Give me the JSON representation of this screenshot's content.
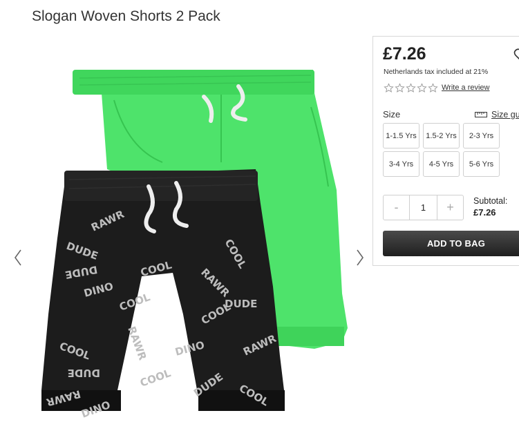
{
  "product": {
    "title": "Slogan Woven Shorts 2 Pack",
    "price": "£7.26",
    "tax_note": "Netherlands tax included at 21%",
    "rating_stars": 0,
    "review_link": "Write a review"
  },
  "size": {
    "label": "Size",
    "guide_label": "Size gui",
    "options": [
      "1-1.5 Yrs",
      "1.5-2 Yrs",
      "2-3 Yrs",
      "3-4 Yrs",
      "4-5 Yrs",
      "5-6 Yrs"
    ]
  },
  "quantity": {
    "minus": "-",
    "value": "1",
    "plus": "+"
  },
  "subtotal": {
    "label": "Subtotal:",
    "value": "£7.26"
  },
  "cart": {
    "add_label": "ADD TO BAG"
  },
  "image": {
    "print_words": [
      "DINO",
      "COOL",
      "RAWR",
      "DUDE",
      "DINO",
      "COOL",
      "RAWR",
      "DUDE",
      "DINO",
      "COOL",
      "DUDE",
      "RAWR",
      "COOL",
      "DINO",
      "DUDE",
      "RAWR",
      "COOL",
      "DINO",
      "DUDE",
      "COOL"
    ]
  },
  "colors": {
    "green_shorts": "#4ee36b",
    "black_shorts": "#1c1c1c",
    "button": "#2a2a2a"
  },
  "icons": {
    "prev": "chevron-left-icon",
    "next": "chevron-right-icon",
    "wishlist": "heart-icon",
    "star": "star-outline-icon",
    "size_guide": "ruler-icon"
  }
}
